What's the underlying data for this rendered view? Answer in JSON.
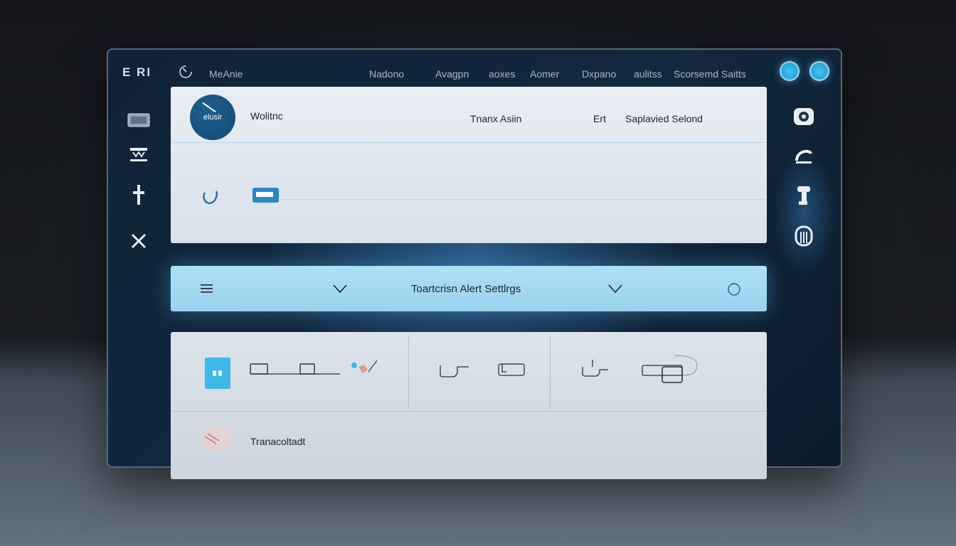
{
  "logo": "E RI",
  "app_name": "MeAnie",
  "nav": [
    "Nadono",
    "Avagpn",
    "aoxes",
    "Aomer",
    "Dxpano",
    "aulitss",
    "Scorsemd Saitts"
  ],
  "panel_top": {
    "badge_text": "elusir",
    "title": "Wolitnc",
    "col1": "Tnanx Asiin",
    "col2": "Ert",
    "col3": "Saplavied Selond"
  },
  "alert_bar": {
    "title": "Toartcrisn Alert Settlrgs"
  },
  "panel_bottom": {
    "row2_label": "Tranacoltadt"
  },
  "colors": {
    "accent": "#2aa6db",
    "alert_bar": "#aee0f6",
    "badge": "#124a74"
  },
  "icons": {
    "left_sidebar": [
      "card-icon",
      "list-icon",
      "plus-icon",
      "close-icon"
    ],
    "right_sidebar": [
      "camera-icon",
      "wave-icon",
      "pin-icon",
      "archive-icon"
    ]
  }
}
